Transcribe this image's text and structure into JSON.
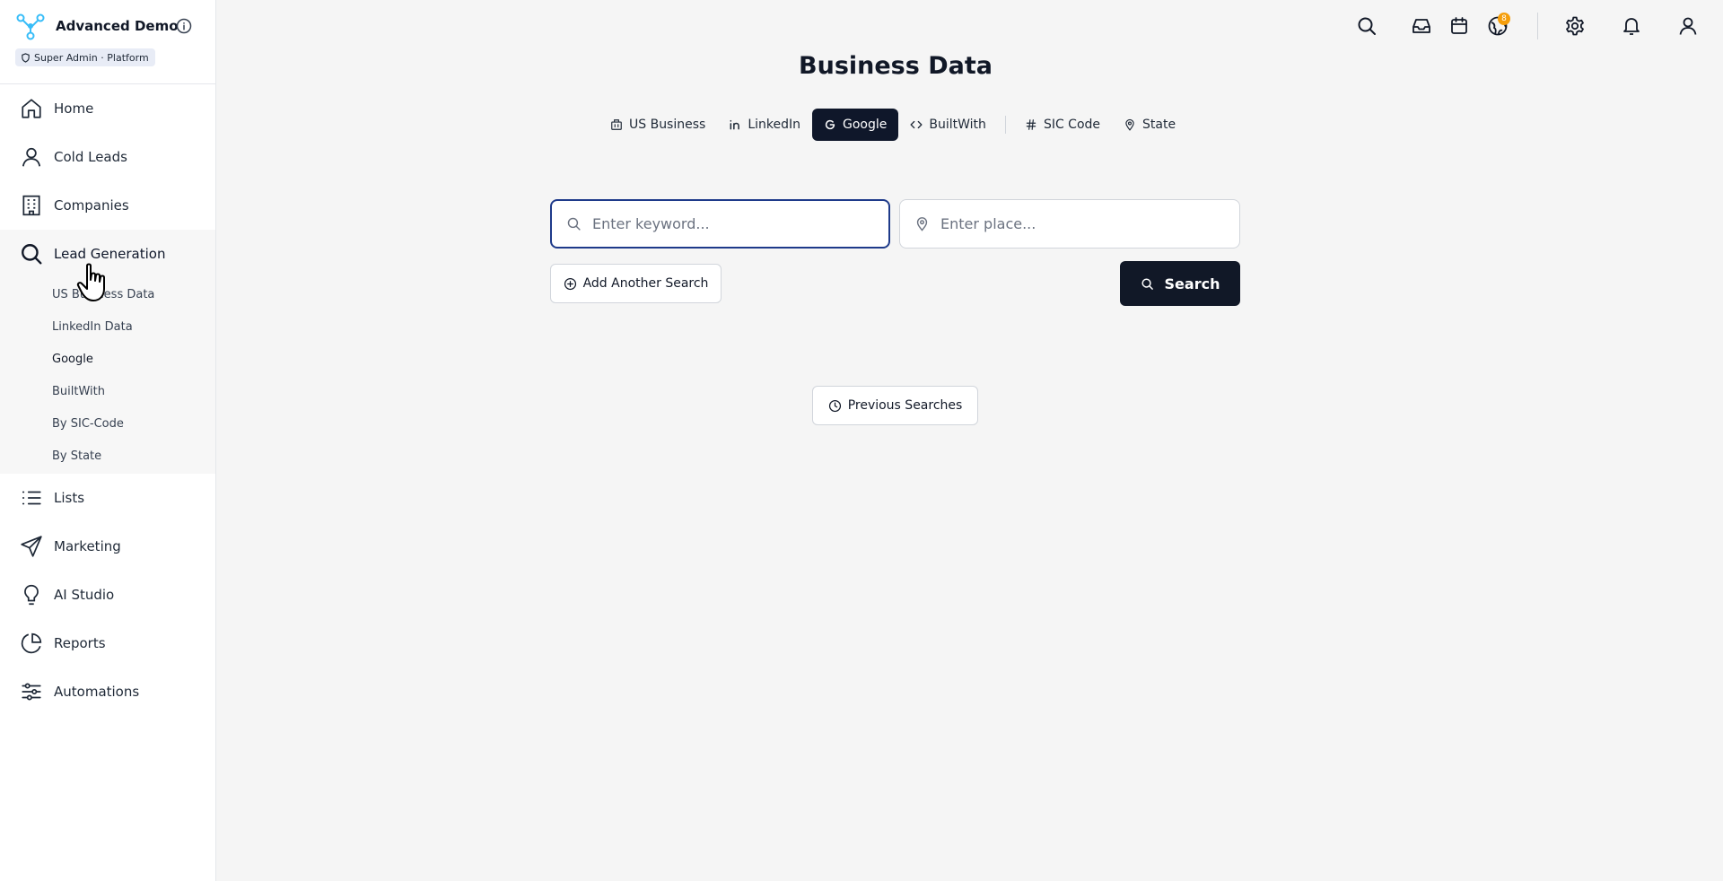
{
  "brand": {
    "name": "Advanced Demo",
    "badge": "Super Admin · Platform"
  },
  "sidebar": {
    "items": [
      {
        "label": "Home",
        "icon": "home-icon"
      },
      {
        "label": "Cold Leads",
        "icon": "user-icon"
      },
      {
        "label": "Companies",
        "icon": "building-icon"
      },
      {
        "label": "Lead Generation",
        "icon": "search-icon"
      },
      {
        "label": "Lists",
        "icon": "list-icon"
      },
      {
        "label": "Marketing",
        "icon": "send-icon"
      },
      {
        "label": "AI Studio",
        "icon": "lightbulb-icon"
      },
      {
        "label": "Reports",
        "icon": "pie-chart-icon"
      },
      {
        "label": "Automations",
        "icon": "sliders-icon"
      }
    ],
    "lead_generation_sub": [
      {
        "label": "US Business Data"
      },
      {
        "label": "LinkedIn Data"
      },
      {
        "label": "Google",
        "active": true
      },
      {
        "label": "BuiltWith"
      },
      {
        "label": "By SIC-Code"
      },
      {
        "label": "By State"
      }
    ]
  },
  "topbar": {
    "icons": [
      "search-icon",
      "inbox-icon",
      "calendar-icon",
      "globe-icon",
      "gear-icon",
      "bell-icon",
      "user-icon"
    ],
    "notification_count": "8"
  },
  "main": {
    "title": "Business Data",
    "tabs": [
      {
        "label": "US Business",
        "icon": "building-icon"
      },
      {
        "label": "LinkedIn",
        "icon": "linkedin-icon"
      },
      {
        "label": "Google",
        "icon": "google-icon",
        "active": true
      },
      {
        "label": "BuiltWith",
        "icon": "code-icon"
      },
      {
        "label": "SIC Code",
        "icon": "hash-icon"
      },
      {
        "label": "State",
        "icon": "map-pin-icon"
      }
    ],
    "keyword_placeholder": "Enter keyword...",
    "keyword_value": "",
    "place_placeholder": "Enter place...",
    "place_value": "",
    "add_search_label": "Add Another Search",
    "search_label": "Search",
    "previous_searches_label": "Previous Searches"
  },
  "colors": {
    "accent_dark": "#0f172a",
    "focus_border": "#1e3a8a",
    "badge_bg": "#e8ecf6",
    "notification": "#f59e0b",
    "logo": "#38bdf8"
  }
}
